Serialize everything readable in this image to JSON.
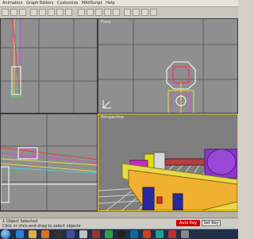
{
  "menu": {
    "items": [
      "Animation",
      "Graph Editors",
      "Customize",
      "MAXScript",
      "Help"
    ]
  },
  "viewports": {
    "top_left": {
      "label": ""
    },
    "top_right": {
      "label": "Front"
    },
    "bottom_left": {
      "label": ""
    },
    "perspective": {
      "label": "Perspective"
    }
  },
  "status": {
    "line1": "1 Object Selected",
    "line2": "Click or click-and-drag to select objects",
    "auto_key": "Auto Key",
    "set_key": "Set Key"
  },
  "taskbar": {
    "icons": [
      "start-orb",
      "ie-icon",
      "folder-icon",
      "media-icon",
      "steam-icon",
      "app-icon",
      "game-icon",
      "app2-icon",
      "chrome-icon",
      "mail-icon",
      "3dsmax-icon",
      "video-icon",
      "app3-icon",
      "tool-icon",
      "misc-icon"
    ]
  },
  "colors": {
    "viewport_bg": "#8f8f8f",
    "active_border": "#f2c700",
    "auto_key": "#cc0000",
    "taskbar": "#1f2f46"
  }
}
